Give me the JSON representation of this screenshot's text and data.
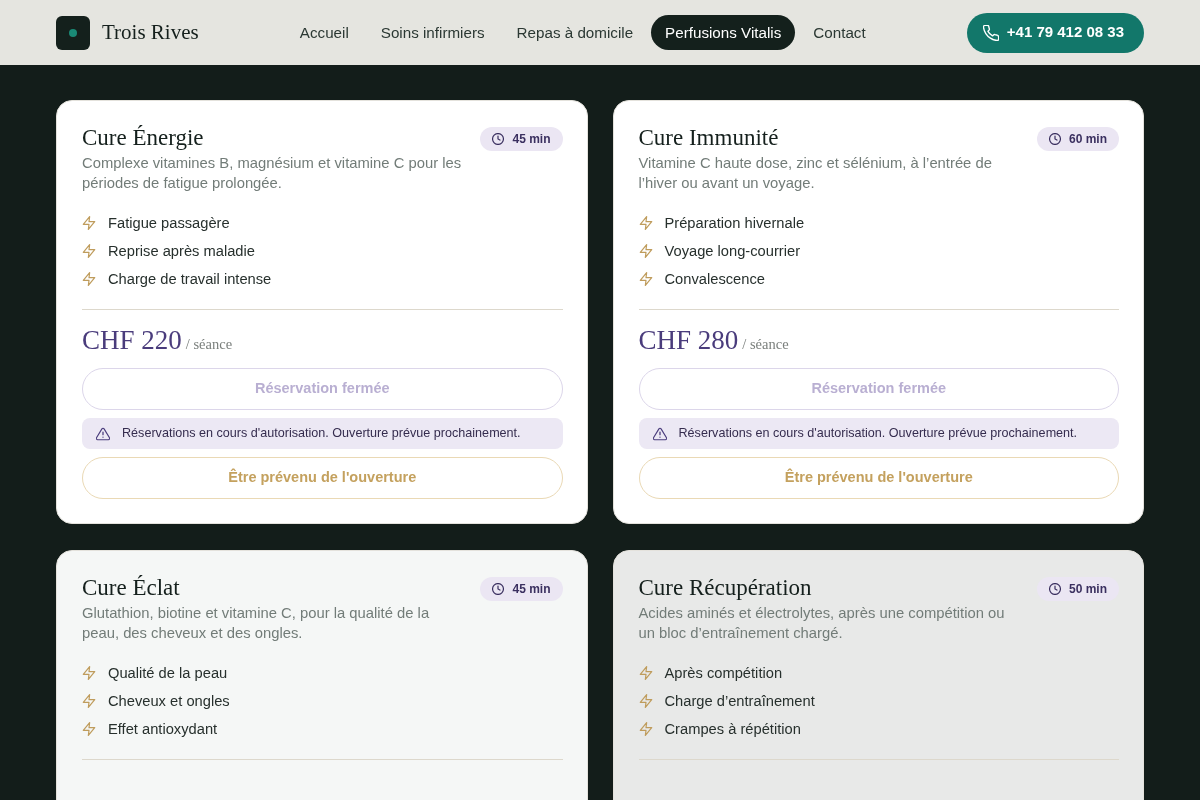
{
  "brand": {
    "name": "Trois Rives"
  },
  "nav": [
    {
      "label": "Accueil",
      "selected": false
    },
    {
      "label": "Soins infirmiers",
      "selected": false
    },
    {
      "label": "Repas à domicile",
      "selected": false
    },
    {
      "label": "Perfusions Vitalis",
      "selected": true
    },
    {
      "label": "Contact",
      "selected": false
    }
  ],
  "phone_button": {
    "label": "+41 79 412 08 33"
  },
  "cures": [
    {
      "title": "Cure Énergie",
      "duration": "45 min",
      "description": "Complexe vitamines B, magnésium et vitamine C pour les périodes de fatigue prolongée.",
      "benefits": [
        "Fatigue passagère",
        "Reprise après maladie",
        "Charge de travail intense"
      ],
      "price": "CHF 220",
      "price_unit": "/ séance",
      "booking_button": {
        "label": "Réservation fermée",
        "disabled": true
      },
      "notice": "Réservations en cours d'autorisation. Ouverture prévue prochainement.",
      "notify_button": {
        "label": "Être prévenu de l'ouverture"
      }
    },
    {
      "title": "Cure Immunité",
      "duration": "60 min",
      "description": "Vitamine C haute dose, zinc et sélénium, à l’entrée de l’hiver ou avant un voyage.",
      "benefits": [
        "Préparation hivernale",
        "Voyage long-courrier",
        "Convalescence"
      ],
      "price": "CHF 280",
      "price_unit": "/ séance",
      "booking_button": {
        "label": "Réservation fermée",
        "disabled": true
      },
      "notice": "Réservations en cours d'autorisation. Ouverture prévue prochainement.",
      "notify_button": {
        "label": "Être prévenu de l'ouverture"
      }
    },
    {
      "title": "Cure Éclat",
      "duration": "45 min",
      "description": "Glutathion, biotine et vitamine C, pour la qualité de la peau, des cheveux et des ongles.",
      "benefits": [
        "Qualité de la peau",
        "Cheveux et ongles",
        "Effet antioxydant"
      ]
    },
    {
      "title": "Cure Récupération",
      "duration": "50 min",
      "description": "Acides aminés et électrolytes, après une compétition ou un bloc d’entraînement chargé.",
      "benefits": [
        "Après compétition",
        "Charge d’entraînement",
        "Crampes à répétition"
      ]
    }
  ]
}
